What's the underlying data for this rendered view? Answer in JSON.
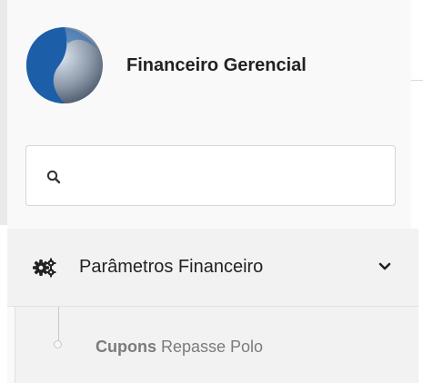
{
  "brand": {
    "title": "Financeiro Gerencial",
    "logo_icon": "swoosh-logo"
  },
  "search": {
    "icon": "search-icon",
    "value": "",
    "placeholder": ""
  },
  "menu": {
    "parent": {
      "icon": "cogs-icon",
      "label": "Parâmetros Financeiro",
      "expanded": true,
      "chevron_icon": "chevron-down-icon"
    },
    "children": [
      {
        "label_strong": "Cupons",
        "label_rest": " Repasse Polo"
      }
    ]
  },
  "colors": {
    "logo_blue": "#1f5fa8",
    "logo_gray": "#8f9aa6",
    "text_dark": "#222222",
    "text_muted": "#7b7b7b"
  }
}
